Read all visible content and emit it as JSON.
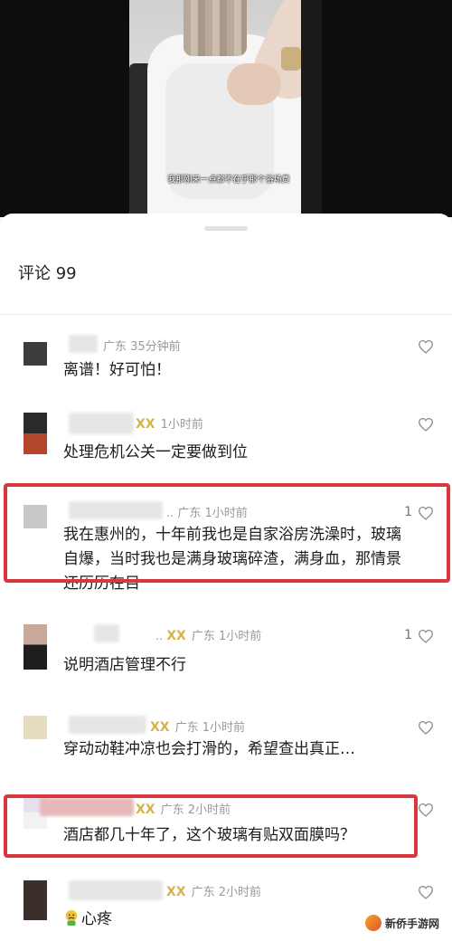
{
  "video": {
    "caption": "我那刚来一点都不在乎那个浴场费"
  },
  "comments_header": {
    "title": "评论 99"
  },
  "comments": [
    {
      "location_time": "广东 35分钟前",
      "text": "离谱！好可怕！",
      "likes": ""
    },
    {
      "location_time": "1小时前",
      "text": "处理危机公关一定要做到位",
      "likes": ""
    },
    {
      "location_time": ".. 广东 1小时前",
      "text_lines": [
        "我在惠州的，十年前我也是自家浴房洗澡时，玻璃",
        "自爆，当时我也是满身玻璃碎渣，满身血，那情景",
        "还历历在目"
      ],
      "likes": "1"
    },
    {
      "location_time": "广东 1小时前",
      "text": "说明酒店管理不行",
      "likes": "1"
    },
    {
      "location_time": "广东 1小时前",
      "text": "穿动动鞋冲凉也会打滑的，希望查出真正…",
      "likes": ""
    },
    {
      "location_time": "广东 2小时前",
      "text": "酒店都几十年了，这个玻璃有贴双面膜吗？",
      "likes": ""
    },
    {
      "location_time": "广东 2小时前",
      "text": "心疼",
      "likes": ""
    }
  ],
  "badge_symbol": "ⅩⅩ",
  "watermark": {
    "text": "新侨手游网"
  },
  "colors": {
    "highlight": "#d9363e",
    "badge": "#d6b24a",
    "meta": "#9a9a9a"
  }
}
